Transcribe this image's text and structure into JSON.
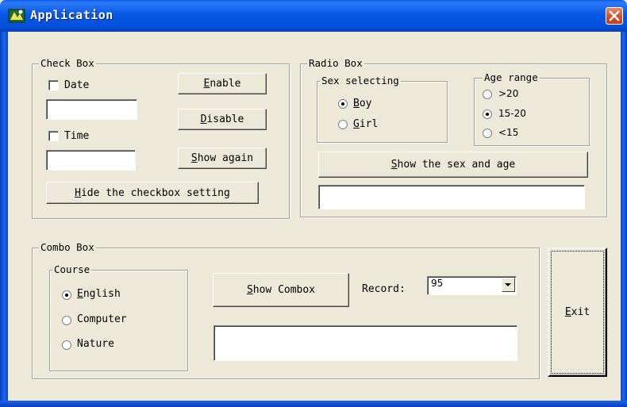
{
  "window": {
    "title": "Application"
  },
  "check_box": {
    "group_label": "Check Box",
    "date_label": "Date",
    "date_accel": "",
    "time_label": "Time",
    "date_value": "",
    "time_value": "",
    "enable_button": {
      "accel": "E",
      "rest": "nable"
    },
    "disable_button": {
      "accel": "D",
      "rest": "isable"
    },
    "show_again_button": {
      "accel": "S",
      "rest": "how again"
    },
    "hide_button": {
      "accel": "H",
      "rest": "ide the checkbox setting"
    }
  },
  "radio_box": {
    "group_label": "Radio Box",
    "sex_group_label": "Sex selecting",
    "boy": {
      "accel": "B",
      "rest": "oy"
    },
    "girl": {
      "accel": "G",
      "rest": "irl"
    },
    "selected_sex": "Boy",
    "age_group_label": "Age range",
    "age_options": [
      ">20",
      "15-20",
      "<15"
    ],
    "selected_age": "15-20",
    "show_button": {
      "accel": "S",
      "rest": "how the sex and age"
    },
    "output_value": ""
  },
  "combo_box": {
    "group_label": "Combo Box",
    "course_group_label": "Course",
    "courses": [
      {
        "accel": "E",
        "rest": "nglish"
      },
      {
        "accel": "",
        "rest": "Computer"
      },
      {
        "accel": "",
        "rest": "Nature"
      }
    ],
    "selected_course": "English",
    "show_combox_button": {
      "accel": "S",
      "rest": "how Combox"
    },
    "record_label": "Record:",
    "record_value": "95",
    "output_value": ""
  },
  "exit_button": {
    "accel": "E",
    "rest": "xit"
  },
  "colors": {
    "titlebar": "#0450DB",
    "face": "#ECE9D8",
    "close": "#D3502C"
  }
}
